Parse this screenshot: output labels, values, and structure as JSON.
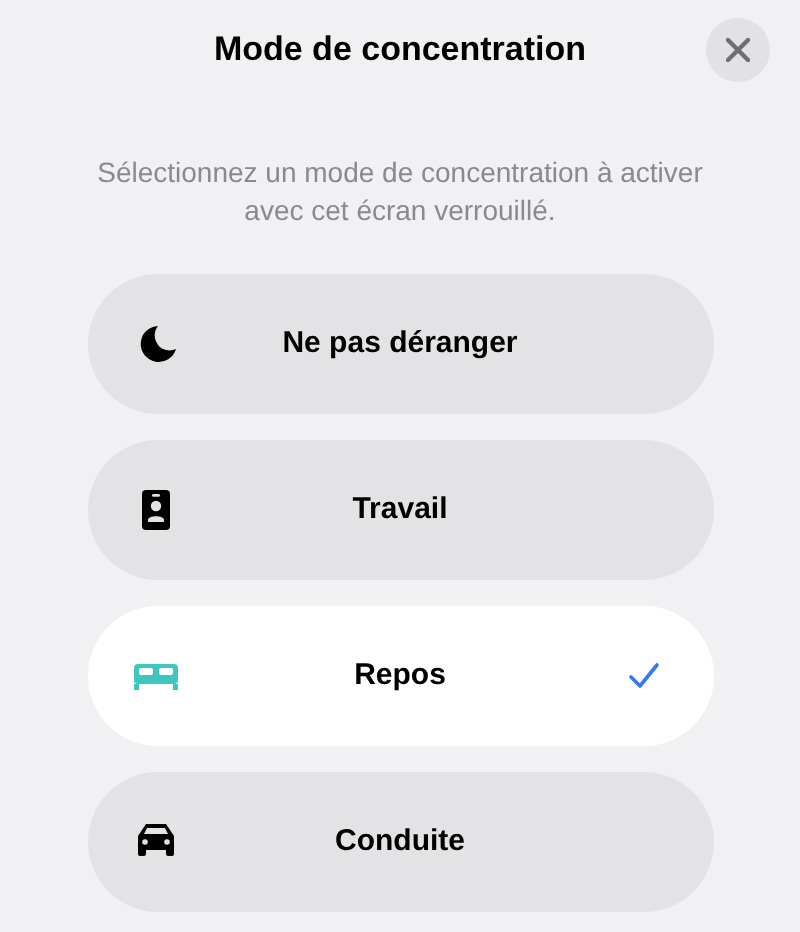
{
  "title": "Mode de concentration",
  "subtitle": "Sélectionnez un mode de concentration à activer avec cet écran verrouillé.",
  "modes": [
    {
      "label": "Ne pas déranger",
      "kind": "moon",
      "color": "#000000",
      "selected": false
    },
    {
      "label": "Travail",
      "kind": "badge",
      "color": "#000000",
      "selected": false
    },
    {
      "label": "Repos",
      "kind": "bed",
      "color": "#3fc7bd",
      "selected": true
    },
    {
      "label": "Conduite",
      "kind": "car",
      "color": "#000000",
      "selected": false
    }
  ]
}
